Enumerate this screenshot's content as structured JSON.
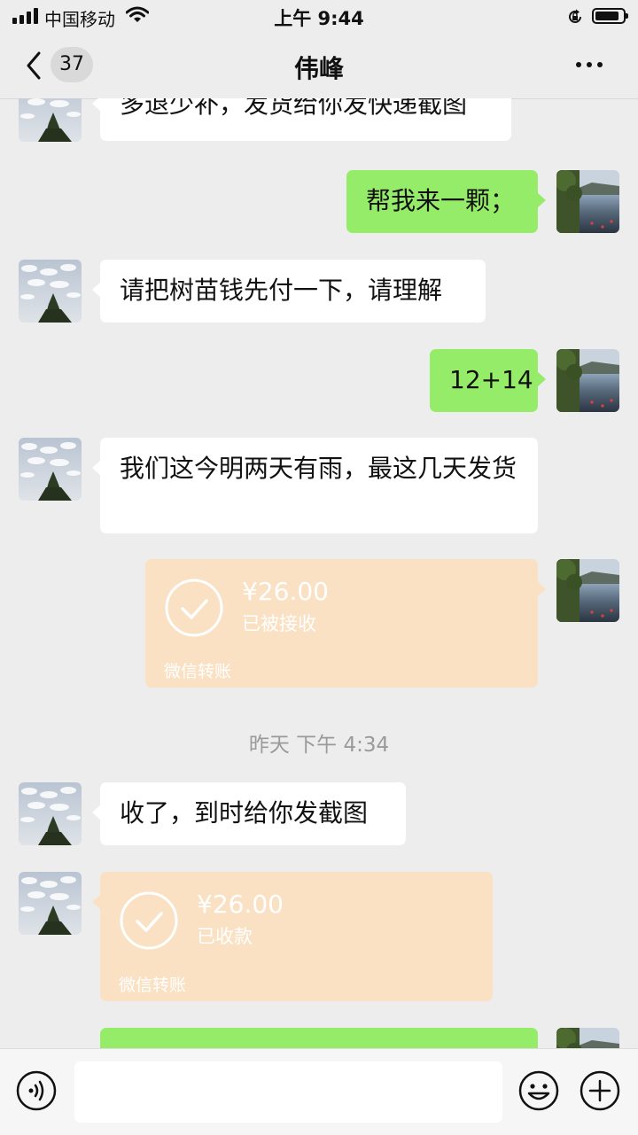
{
  "status_bar": {
    "carrier": "中国移动",
    "time": "上午 9:44"
  },
  "header": {
    "back_count": "37",
    "title": "伟峰",
    "more_icon": "more-dots-icon"
  },
  "messages": [
    {
      "sender": "other",
      "type": "text",
      "text": "多退少补，发货给你发快递截图"
    },
    {
      "sender": "me",
      "type": "text",
      "text": "帮我来一颗；"
    },
    {
      "sender": "other",
      "type": "text",
      "text": "请把树苗钱先付一下，请理解"
    },
    {
      "sender": "me",
      "type": "text",
      "text": "12+14"
    },
    {
      "sender": "other",
      "type": "text",
      "text": "我们这今明两天有雨，最这几天发货"
    },
    {
      "sender": "me",
      "type": "transfer",
      "amount": "¥26.00",
      "status": "已被接收",
      "label": "微信转账"
    },
    {
      "type": "timestamp",
      "text": "昨天 下午 4:34"
    },
    {
      "sender": "other",
      "type": "text",
      "text": "收了，到时给你发截图"
    },
    {
      "sender": "other",
      "type": "transfer",
      "amount": "¥26.00",
      "status": "已收款",
      "label": "微信转账"
    },
    {
      "sender": "me",
      "type": "text",
      "text": ""
    }
  ],
  "input_bar": {
    "voice_icon": "voice-icon",
    "text_value": "",
    "emoji_icon": "emoji-icon",
    "plus_icon": "plus-icon"
  },
  "colors": {
    "background": "#ededed",
    "my_bubble": "#95ec69",
    "their_bubble": "#ffffff",
    "transfer_accepted": "#fbe1c4"
  }
}
